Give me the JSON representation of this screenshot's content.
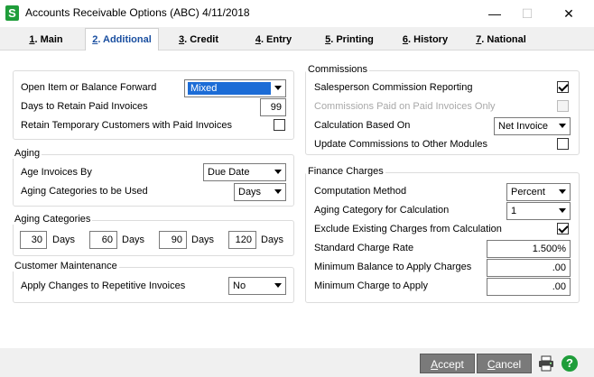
{
  "window": {
    "app_icon": "S",
    "title": "Accounts Receivable Options (ABC) 4/11/2018",
    "minimize_glyph": "—",
    "maximize_glyph": "☐",
    "close_glyph": "✕"
  },
  "tabs": [
    {
      "key": "1",
      "rest": ". Main"
    },
    {
      "key": "2",
      "rest": ". Additional"
    },
    {
      "key": "3",
      "rest": ". Credit"
    },
    {
      "key": "4",
      "rest": ". Entry"
    },
    {
      "key": "5",
      "rest": ". Printing"
    },
    {
      "key": "6",
      "rest": ". History"
    },
    {
      "key": "7",
      "rest": ". National"
    }
  ],
  "general": {
    "open_item_label": "Open Item or Balance Forward",
    "open_item_value": "Mixed",
    "days_retain_label": "Days to Retain Paid Invoices",
    "days_retain_value": "99",
    "retain_temp_label": "Retain Temporary Customers with Paid Invoices",
    "retain_temp_checked": false
  },
  "aging": {
    "legend": "Aging",
    "age_by_label": "Age Invoices By",
    "age_by_value": "Due Date",
    "categories_used_label": "Aging Categories to be Used",
    "categories_used_value": "Days"
  },
  "aging_categories": {
    "legend": "Aging Categories",
    "values": [
      "30",
      "60",
      "90",
      "120"
    ],
    "unit": "Days"
  },
  "customer_maintenance": {
    "legend": "Customer Maintenance",
    "apply_changes_label": "Apply Changes to Repetitive Invoices",
    "apply_changes_value": "No"
  },
  "commissions": {
    "legend": "Commissions",
    "salesperson_label": "Salesperson Commission Reporting",
    "salesperson_checked": true,
    "paid_only_label": "Commissions Paid on Paid Invoices Only",
    "paid_only_checked": false,
    "calc_based_label": "Calculation Based On",
    "calc_based_value": "Net Invoice",
    "update_label": "Update Commissions to Other Modules",
    "update_checked": false
  },
  "finance": {
    "legend": "Finance Charges",
    "method_label": "Computation Method",
    "method_value": "Percent",
    "aging_cat_label": "Aging Category for Calculation",
    "aging_cat_value": "1",
    "exclude_label": "Exclude Existing Charges from Calculation",
    "exclude_checked": true,
    "rate_label": "Standard Charge Rate",
    "rate_value": "1.500%",
    "min_balance_label": "Minimum Balance to Apply Charges",
    "min_balance_value": ".00",
    "min_charge_label": "Minimum Charge to Apply",
    "min_charge_value": ".00"
  },
  "footer": {
    "accept_key": "A",
    "accept_rest": "ccept",
    "cancel_key": "C",
    "cancel_rest": "ancel",
    "help_glyph": "?"
  },
  "colors": {
    "accent": "#1c6cd6",
    "button_gray": "#7a7a7a",
    "help_green": "#1f9d3a"
  }
}
